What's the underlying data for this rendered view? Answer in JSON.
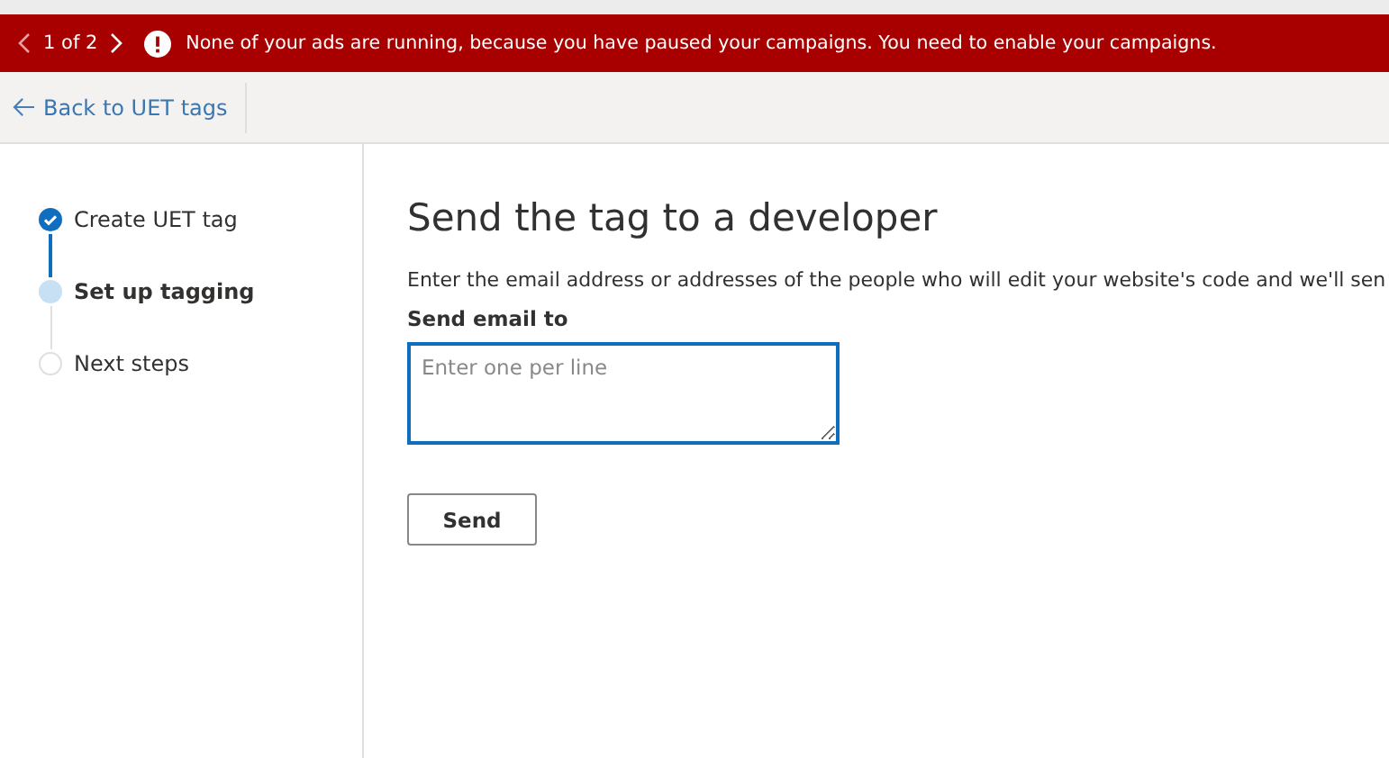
{
  "banner": {
    "pager": "1 of 2",
    "message": "None of your ads are running, because you have paused your campaigns. You need to enable your campaigns."
  },
  "toolbar": {
    "back_link": "Back to UET tags"
  },
  "steps": [
    {
      "label": "Create UET tag",
      "kind": "done"
    },
    {
      "label": "Set up tagging",
      "kind": "current"
    },
    {
      "label": "Next steps",
      "kind": "pending"
    }
  ],
  "content": {
    "title": "Send the tag to a developer",
    "description": "Enter the email address or addresses of the people who will edit your website's code and we'll sen",
    "field_label": "Send email to",
    "email_field": {
      "placeholder": "Enter one per line"
    },
    "send_button": "Send"
  }
}
